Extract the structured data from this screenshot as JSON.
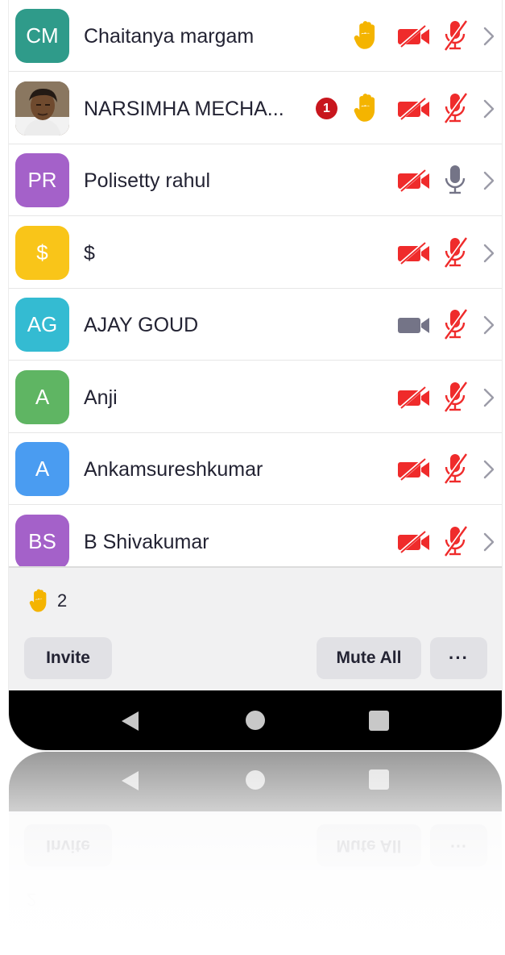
{
  "colors": {
    "muted_red": "#ef2b2b",
    "hand_yellow": "#f4b400",
    "icon_gray": "#747487",
    "chevron_gray": "#9c9ca8",
    "badge_red": "#c8161d"
  },
  "participants": [
    {
      "initials": "CM",
      "name": "Chaitanya margam",
      "avatar_color": "#2f9b8a",
      "photo": false,
      "badge": "",
      "hand_raised": true,
      "video_off": true,
      "mic_muted": true
    },
    {
      "initials": "",
      "name": "NARSIMHA MECHA...",
      "avatar_color": "#6b5a45",
      "photo": true,
      "badge": "1",
      "hand_raised": true,
      "video_off": true,
      "mic_muted": true
    },
    {
      "initials": "PR",
      "name": "Polisetty rahul",
      "avatar_color": "#a461c9",
      "photo": false,
      "badge": "",
      "hand_raised": false,
      "video_off": true,
      "mic_muted": false
    },
    {
      "initials": "$",
      "name": "$",
      "avatar_color": "#f9c519",
      "photo": false,
      "badge": "",
      "hand_raised": false,
      "video_off": true,
      "mic_muted": true
    },
    {
      "initials": "AG",
      "name": "AJAY GOUD",
      "avatar_color": "#34bbd2",
      "photo": false,
      "badge": "",
      "hand_raised": false,
      "video_off": false,
      "mic_muted": true
    },
    {
      "initials": "A",
      "name": "Anji",
      "avatar_color": "#5fb563",
      "photo": false,
      "badge": "",
      "hand_raised": false,
      "video_off": true,
      "mic_muted": true
    },
    {
      "initials": "A",
      "name": "Ankamsureshkumar",
      "avatar_color": "#4a9cf1",
      "photo": false,
      "badge": "",
      "hand_raised": false,
      "video_off": true,
      "mic_muted": true
    },
    {
      "initials": "BS",
      "name": "B Shivakumar",
      "avatar_color": "#a461c9",
      "photo": false,
      "badge": "",
      "hand_raised": false,
      "video_off": true,
      "mic_muted": true
    }
  ],
  "footer": {
    "raised_hands_count": "2",
    "invite_label": "Invite",
    "mute_all_label": "Mute All",
    "more_label": "···"
  },
  "navbar": {
    "back_icon": "triangle-back-icon",
    "home_icon": "circle-home-icon",
    "recents_icon": "square-recents-icon"
  }
}
